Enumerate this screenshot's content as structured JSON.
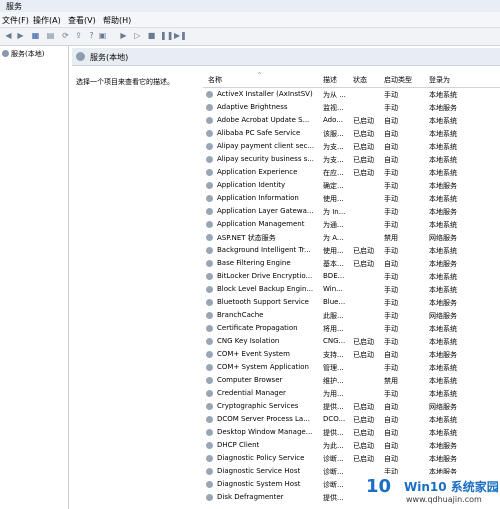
{
  "window": {
    "title": "服务"
  },
  "menu": [
    {
      "label": "文件(F)"
    },
    {
      "label": "操作(A)"
    },
    {
      "label": "查看(V)"
    },
    {
      "label": "帮助(H)"
    }
  ],
  "toolbar": {
    "icons": [
      "back-icon",
      "forward-icon",
      "show-tree-icon",
      "console-icon",
      "refresh-icon",
      "export-icon",
      "help-icon",
      "properties-icon",
      "play-icon",
      "stop-icon",
      "pause-icon",
      "restart-icon"
    ]
  },
  "tree": {
    "root_label": "服务(本地)"
  },
  "panel": {
    "header_title": "服务(本地)",
    "description_hint": "选择一个项目来查看它的描述。"
  },
  "table": {
    "columns": [
      "名称",
      "描述",
      "状态",
      "启动类型",
      "登录为"
    ],
    "rows": [
      [
        "ActiveX Installer (AxInstSV)",
        "为从 ...",
        "",
        "手动",
        "本地系统"
      ],
      [
        "Adaptive Brightness",
        "监视...",
        "",
        "手动",
        "本地服务"
      ],
      [
        "Adobe Acrobat Update S...",
        "Ado...",
        "已启动",
        "自动",
        "本地系统"
      ],
      [
        "Alibaba PC Safe Service",
        "该服...",
        "已启动",
        "自动",
        "本地系统"
      ],
      [
        "Alipay payment client sec...",
        "为支...",
        "已启动",
        "自动",
        "本地系统"
      ],
      [
        "Alipay security business s...",
        "为支...",
        "已启动",
        "自动",
        "本地系统"
      ],
      [
        "Application Experience",
        "在应...",
        "已启动",
        "手动",
        "本地系统"
      ],
      [
        "Application Identity",
        "确定...",
        "",
        "手动",
        "本地服务"
      ],
      [
        "Application Information",
        "使用...",
        "",
        "手动",
        "本地系统"
      ],
      [
        "Application Layer Gatewa...",
        "为 In...",
        "",
        "手动",
        "本地服务"
      ],
      [
        "Application Management",
        "为通...",
        "",
        "手动",
        "本地系统"
      ],
      [
        "ASP.NET 状态服务",
        "为 A...",
        "",
        "禁用",
        "网络服务"
      ],
      [
        "Background Intelligent Tr...",
        "使用...",
        "已启动",
        "手动",
        "本地系统"
      ],
      [
        "Base Filtering Engine",
        "基本...",
        "已启动",
        "自动",
        "本地服务"
      ],
      [
        "BitLocker Drive Encryptio...",
        "BDE...",
        "",
        "手动",
        "本地系统"
      ],
      [
        "Block Level Backup Engin...",
        "Win...",
        "",
        "手动",
        "本地系统"
      ],
      [
        "Bluetooth Support Service",
        "Blue...",
        "",
        "手动",
        "本地服务"
      ],
      [
        "BranchCache",
        "此服...",
        "",
        "手动",
        "网络服务"
      ],
      [
        "Certificate Propagation",
        "将用...",
        "",
        "手动",
        "本地系统"
      ],
      [
        "CNG Key Isolation",
        "CNG...",
        "已启动",
        "手动",
        "本地系统"
      ],
      [
        "COM+ Event System",
        "支持...",
        "已启动",
        "自动",
        "本地服务"
      ],
      [
        "COM+ System Application",
        "管理...",
        "",
        "手动",
        "本地系统"
      ],
      [
        "Computer Browser",
        "维护...",
        "",
        "禁用",
        "本地系统"
      ],
      [
        "Credential Manager",
        "为用...",
        "",
        "手动",
        "本地系统"
      ],
      [
        "Cryptographic Services",
        "提供...",
        "已启动",
        "自动",
        "网络服务"
      ],
      [
        "DCOM Server Process La...",
        "DCO...",
        "已启动",
        "自动",
        "本地系统"
      ],
      [
        "Desktop Window Manage...",
        "提供...",
        "已启动",
        "自动",
        "本地系统"
      ],
      [
        "DHCP Client",
        "为此...",
        "已启动",
        "自动",
        "本地服务"
      ],
      [
        "Diagnostic Policy Service",
        "诊断...",
        "已启动",
        "自动",
        "本地服务"
      ],
      [
        "Diagnostic Service Host",
        "诊断...",
        "",
        "手动",
        "本地服务"
      ],
      [
        "Diagnostic System Host",
        "诊断...",
        "",
        "手动",
        "本地系统"
      ],
      [
        "Disk Defragmenter",
        "提供...",
        "",
        "手动",
        "本地系统"
      ]
    ]
  },
  "watermark": {
    "logo": "10",
    "brand": "Win10 系统家园",
    "url": "www.qdhuajin.com"
  }
}
